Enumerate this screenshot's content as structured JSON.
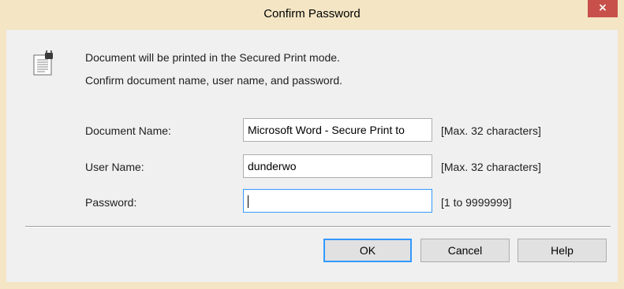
{
  "window": {
    "title": "Confirm Password",
    "close_glyph": "×"
  },
  "message": {
    "line1": "Document will be printed in the Secured Print mode.",
    "line2": "Confirm document name, user name, and password.",
    "icon": "secure-document-icon"
  },
  "form": {
    "document_name": {
      "label": "Document Name:",
      "value": "Microsoft Word - Secure Print to",
      "hint": "[Max. 32 characters]"
    },
    "user_name": {
      "label": "User Name:",
      "value": "dunderwo",
      "hint": "[Max. 32 characters]"
    },
    "password": {
      "label": "Password:",
      "value": "",
      "hint": "[1 to 9999999]"
    }
  },
  "buttons": {
    "ok": "OK",
    "cancel": "Cancel",
    "help": "Help"
  },
  "colors": {
    "frame": "#f4e6c4",
    "close": "#c7504a",
    "focus": "#3399ff"
  }
}
